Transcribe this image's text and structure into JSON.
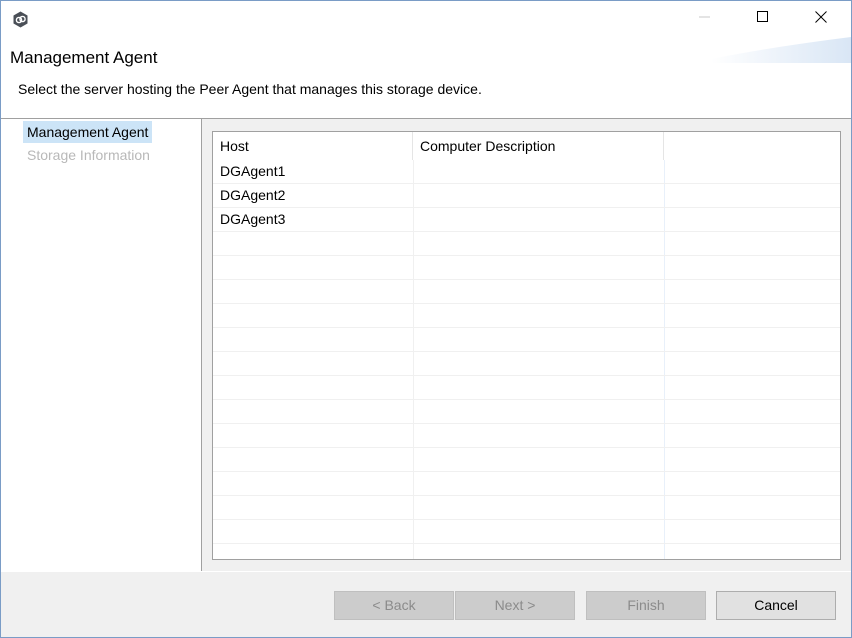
{
  "window": {
    "controls": {
      "minimize_icon": "minimize-icon",
      "maximize_icon": "maximize-icon",
      "close_icon": "close-icon"
    }
  },
  "header": {
    "title": "Management Agent",
    "subtitle": "Select the server hosting the Peer Agent that manages this storage device."
  },
  "nav": {
    "items": [
      {
        "label": "Management Agent",
        "state": "selected"
      },
      {
        "label": "Storage Information",
        "state": "disabled"
      }
    ]
  },
  "table": {
    "columns": [
      "Host",
      "Computer Description",
      ""
    ],
    "rows": [
      [
        "DGAgent1",
        "",
        ""
      ],
      [
        "DGAgent2",
        "",
        ""
      ],
      [
        "DGAgent3",
        "",
        ""
      ]
    ]
  },
  "buttons": {
    "back": "< Back",
    "next": "Next >",
    "finish": "Finish",
    "cancel": "Cancel"
  },
  "colors": {
    "selection": "#cce4f7",
    "disabled_text": "#b8b8b8",
    "dialog_background": "#f0f0f0",
    "disabled_button": "#cccccc",
    "border": "#a0a0a0"
  }
}
